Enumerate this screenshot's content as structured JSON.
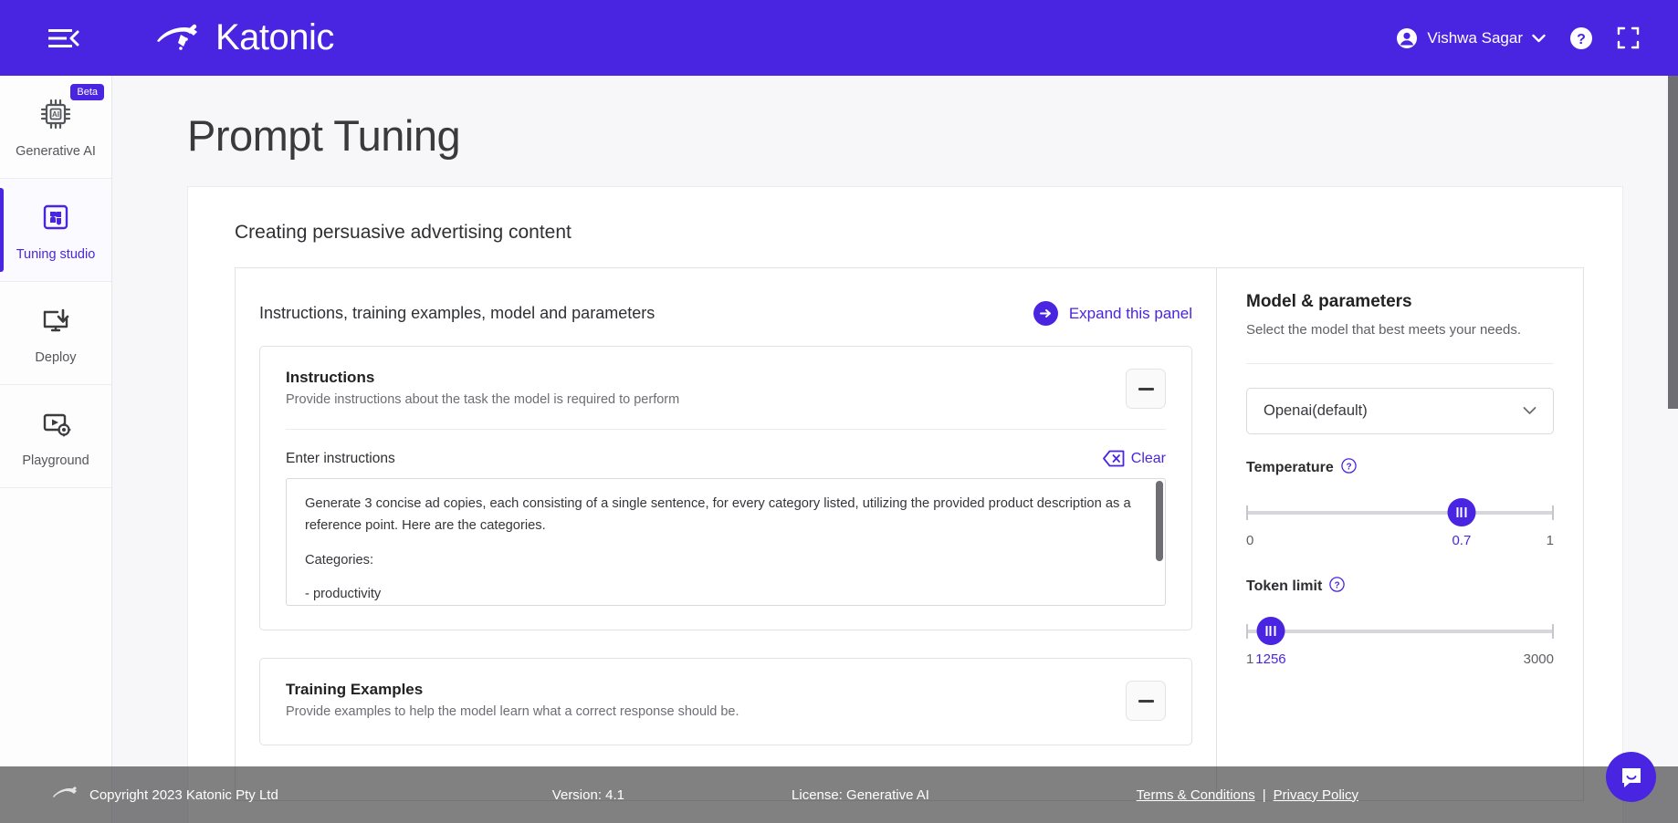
{
  "header": {
    "brand": "Katonic",
    "menu_icon": "hamburger-menu-icon",
    "user_name": "Vishwa Sagar",
    "help_icon": "help-circle-icon",
    "fullscreen_icon": "fullscreen-icon"
  },
  "sidebar": {
    "items": [
      {
        "label": "Generative AI",
        "icon": "ai-chip-icon",
        "badge": "Beta",
        "active": false
      },
      {
        "label": "Tuning studio",
        "icon": "puzzle-icon",
        "badge": "",
        "active": true
      },
      {
        "label": "Deploy",
        "icon": "monitor-download-icon",
        "badge": "",
        "active": false
      },
      {
        "label": "Playground",
        "icon": "video-settings-icon",
        "badge": "",
        "active": false
      }
    ]
  },
  "main": {
    "page_title": "Prompt Tuning",
    "card_heading": "Creating persuasive advertising content",
    "panel_title": "Instructions, training examples, model and parameters",
    "expand_label": "Expand this panel",
    "instructions": {
      "title": "Instructions",
      "description": "Provide instructions about the task the model is required to perform",
      "field_label": "Enter instructions",
      "clear_label": "Clear",
      "value_p1": "Generate 3 concise ad copies, each consisting of a single sentence, for every category listed, utilizing the provided product description as a reference point. Here are the categories.",
      "value_p2": "Categories:",
      "value_p3": "-  productivity"
    },
    "training_examples": {
      "title": "Training Examples",
      "description": "Provide examples to help the model learn what a correct response should be."
    }
  },
  "parameters": {
    "title": "Model & parameters",
    "description": "Select the model that best meets your needs.",
    "model_value": "Openai(default)",
    "temperature": {
      "label": "Temperature",
      "value": "0.7",
      "min": "0",
      "max": "1",
      "percent": 70
    },
    "token_limit": {
      "label": "Token limit",
      "value": "1256",
      "min": "1",
      "max": "3000",
      "percent": 8
    }
  },
  "footer": {
    "copyright": "Copyright 2023 Katonic Pty Ltd",
    "version": "Version: 4.1",
    "license": "License: Generative AI",
    "terms": "Terms & Conditions",
    "separator": "|",
    "privacy": "Privacy Policy"
  },
  "chat": {
    "icon": "chat-bubble-icon"
  },
  "colors": {
    "brand": "#4a25e1",
    "page_bg": "#f7f7f9"
  }
}
